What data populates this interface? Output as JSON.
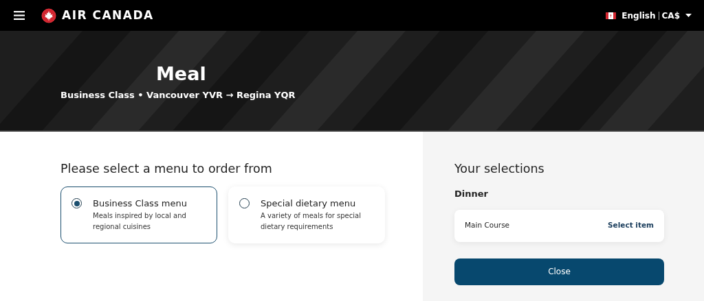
{
  "header": {
    "brand": "AIR CANADA",
    "language": "English",
    "currency": "CA$"
  },
  "hero": {
    "title": "Meal",
    "subtitle": "Business Class • Vancouver YVR → Regina YQR"
  },
  "menu_choice": {
    "heading": "Please select a menu to order from",
    "options": [
      {
        "title": "Business Class menu",
        "description": "Meals inspired by local and regional cuisines",
        "selected": true
      },
      {
        "title": "Special dietary menu",
        "description": "A variety of meals for special dietary requirements",
        "selected": false
      }
    ]
  },
  "selections": {
    "heading": "Your selections",
    "meal": "Dinner",
    "items": [
      {
        "label": "Main Course",
        "action": "Select item"
      }
    ],
    "close_button": "Close"
  }
}
